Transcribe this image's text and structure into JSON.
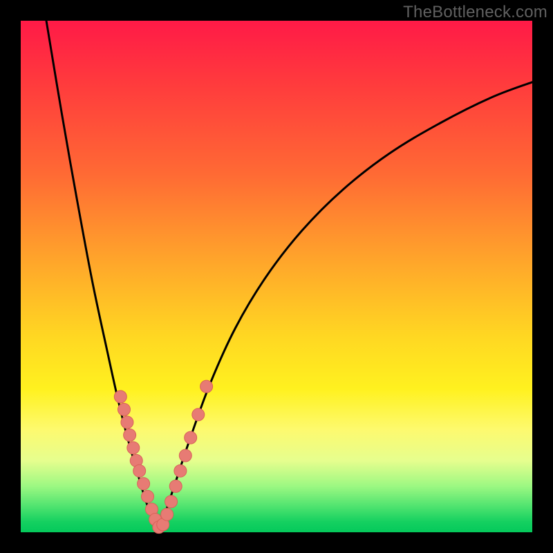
{
  "watermark": "TheBottleneck.com",
  "colors": {
    "frame": "#000000",
    "curve": "#000000",
    "dot_fill": "#e77b74",
    "dot_stroke": "#d86259",
    "gradient_top": "#ff1a47",
    "gradient_bottom": "#05c95b"
  },
  "chart_data": {
    "type": "line",
    "title": "",
    "xlabel": "",
    "ylabel": "",
    "xlim": [
      0,
      100
    ],
    "ylim": [
      0,
      100
    ],
    "grid": false,
    "legend": false,
    "note": "Axes are unlabeled; values are estimated from pixel positions on a 0–100 normalized scale. y=0 at bottom (green), y=100 at top (red). Two black curves meet near x≈26, y≈0. Salmon dots cluster along lower portions of both curves.",
    "series": [
      {
        "name": "left-curve",
        "x": [
          5,
          8,
          11,
          14,
          17,
          19,
          21,
          23,
          24.5,
          26,
          27
        ],
        "y": [
          100,
          82,
          65,
          49,
          35,
          26,
          18,
          11,
          6,
          2,
          0
        ]
      },
      {
        "name": "right-curve",
        "x": [
          27,
          28,
          30,
          33,
          37,
          42,
          48,
          55,
          63,
          72,
          82,
          92,
          100
        ],
        "y": [
          0,
          3,
          9,
          18,
          29,
          40,
          50,
          59,
          67,
          74,
          80,
          85,
          88
        ]
      },
      {
        "name": "dots",
        "marker_only": true,
        "x": [
          19.5,
          20.2,
          20.8,
          21.3,
          22.0,
          22.6,
          23.2,
          24.0,
          24.8,
          25.6,
          26.3,
          27.0,
          27.8,
          28.6,
          29.4,
          30.3,
          31.2,
          32.2,
          33.2,
          34.7,
          36.3
        ],
        "y": [
          26.5,
          24.0,
          21.5,
          19.0,
          16.5,
          14.0,
          12.0,
          9.5,
          7.0,
          4.5,
          2.5,
          1.0,
          1.5,
          3.5,
          6.0,
          9.0,
          12.0,
          15.0,
          18.5,
          23.0,
          28.5
        ]
      }
    ]
  }
}
